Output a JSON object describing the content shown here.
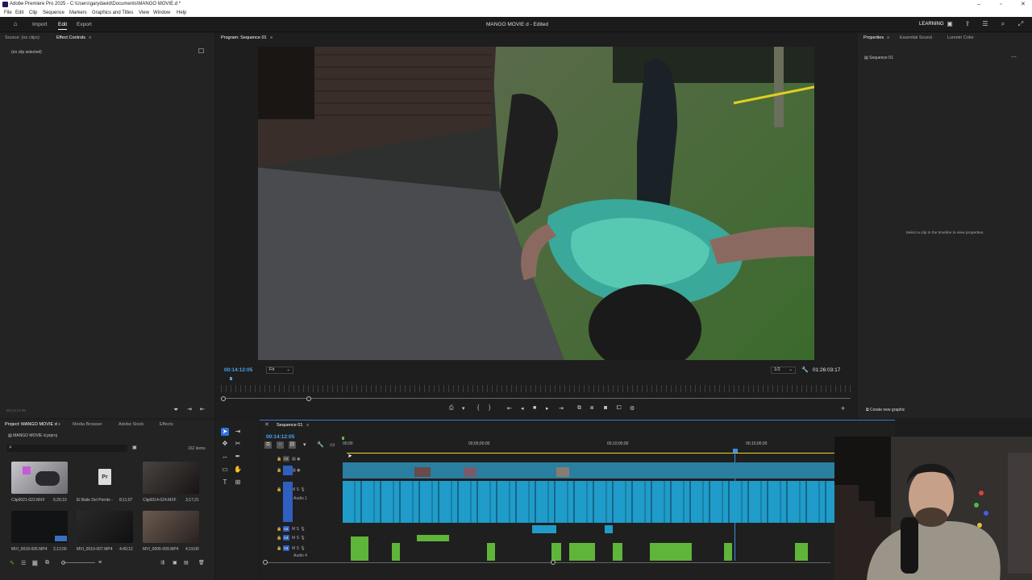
{
  "window": {
    "title": "Adobe Premiere Pro 2025 - C:\\Users\\garydavid\\Documents\\MANGO MOVIE.d *"
  },
  "menu": [
    "File",
    "Edit",
    "Clip",
    "Sequence",
    "Markers",
    "Graphics and Titles",
    "View",
    "Window",
    "Help"
  ],
  "header": {
    "nav": [
      "Import",
      "Edit",
      "Export"
    ],
    "active_nav": "Edit",
    "document_title": "MANGO MOVIE d",
    "document_status": "- Edited",
    "learning": "LEARNING"
  },
  "source_panel": {
    "tabs": [
      "Source: (no clips)",
      "Effect Controls"
    ],
    "active_tab": "Effect Controls",
    "message": "(no clip selected)",
    "timecode": "00:14:12:05"
  },
  "program_monitor": {
    "tab": "Program: Sequence 01",
    "timecode": "00:14:12:05",
    "fit": "Fit",
    "resolution": "1/2",
    "duration": "01:26:03:17"
  },
  "properties_panel": {
    "tabs": [
      "Properties",
      "Essential Sound",
      "Lumetri Color"
    ],
    "active_tab": "Properties",
    "sequence": "Sequence 01",
    "hint": "Select a clip in the timeline to view properties.",
    "create_graphic": "Create new graphic"
  },
  "project_panel": {
    "tabs": [
      "Project: MANGO MOVIE d",
      "Media Browser",
      "Adobe Stock",
      "Effects"
    ],
    "active_tab": "Project: MANGO MOVIE d",
    "project_file": "MANGO MOVIE d.prproj",
    "items_count": "162 items",
    "items": [
      {
        "name": "Clip0021-022.MXF",
        "duration": "5;26;10"
      },
      {
        "name": "El Baile Del Perrito -",
        "duration": "8;11;07"
      },
      {
        "name": "Clip0014-024.MXF",
        "duration": "3;17;21"
      },
      {
        "name": "MVI_0018-005.MP4",
        "duration": "2;12;00"
      },
      {
        "name": "MVI_0010-007.MP4",
        "duration": "4;40;12"
      },
      {
        "name": "MVI_0006-009.MP4",
        "duration": "4;19;00"
      }
    ]
  },
  "timeline": {
    "tab": "Sequence 01",
    "timecode": "00:14:12:05",
    "ruler": [
      "00;00",
      "00;05;00;00",
      "00;10;00;00",
      "00;15;00;00"
    ],
    "tracks": [
      {
        "name": "V2"
      },
      {
        "name": "V1"
      },
      {
        "name": "A1",
        "label": "Audio 1"
      },
      {
        "name": "A2"
      },
      {
        "name": "A3"
      },
      {
        "name": "A4",
        "label": "Audio 4"
      }
    ]
  },
  "colors": {
    "accent_blue": "#2d72d9",
    "timecode_blue": "#4aa3f0",
    "audio_clip": "#1f9cc9",
    "green_clip": "#5fb43a",
    "playhead": "#3a8ee6"
  }
}
